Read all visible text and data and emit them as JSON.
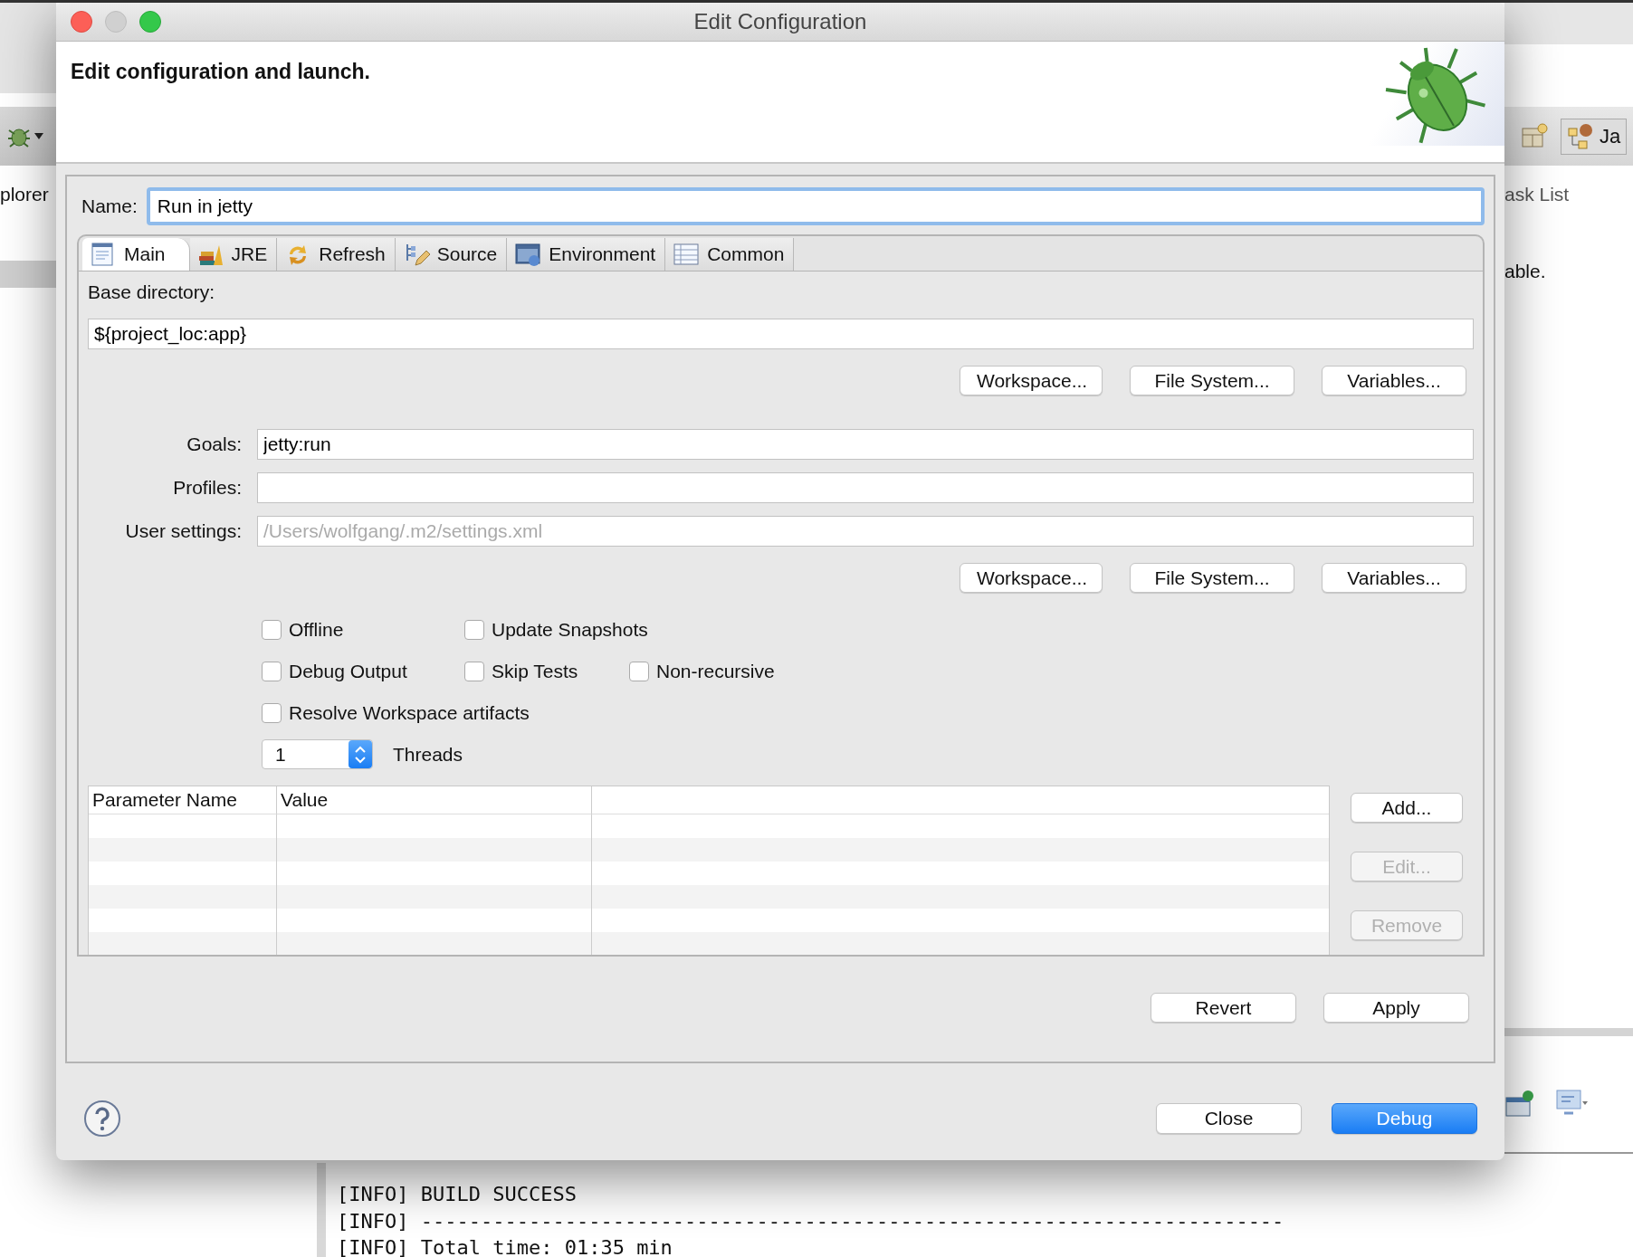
{
  "background": {
    "left_view_tab": "plorer",
    "right_view_tab": "ask List",
    "right_view_text": "able.",
    "perspective": "Ja",
    "console": [
      "[INFO] BUILD SUCCESS",
      "[INFO] ------------------------------------------------------------------------",
      "[INFO] Total time: 01:35 min"
    ]
  },
  "window": {
    "title": "Edit Configuration"
  },
  "header": {
    "message": "Edit configuration and launch."
  },
  "name_field": {
    "label": "Name:",
    "value": "Run in jetty",
    "focused": true
  },
  "tabs": [
    {
      "label": "Main",
      "selected": true
    },
    {
      "label": "JRE",
      "selected": false
    },
    {
      "label": "Refresh",
      "selected": false
    },
    {
      "label": "Source",
      "selected": false
    },
    {
      "label": "Environment",
      "selected": false
    },
    {
      "label": "Common",
      "selected": false
    }
  ],
  "base_directory": {
    "label": "Base directory:",
    "value": "${project_loc:app}",
    "buttons": [
      "Workspace...",
      "File System...",
      "Variables..."
    ]
  },
  "fields": [
    {
      "label": "Goals:",
      "value": "jetty:run"
    },
    {
      "label": "Profiles:"
    },
    {
      "label": "User settings:",
      "placeholder": "/Users/wolfgang/.m2/settings.xml"
    }
  ],
  "settings_buttons": [
    "Workspace...",
    "File System...",
    "Variables..."
  ],
  "options": [
    [
      {
        "label": "Offline",
        "checked": false
      },
      {
        "label": "Update Snapshots",
        "checked": false
      }
    ],
    [
      {
        "label": "Debug Output",
        "checked": false
      },
      {
        "label": "Skip Tests",
        "checked": false
      },
      {
        "label": "Non-recursive",
        "checked": false
      }
    ],
    [
      {
        "label": "Resolve Workspace artifacts",
        "checked": false
      }
    ]
  ],
  "threads": {
    "value": "1",
    "label": "Threads"
  },
  "parameters": {
    "columns": [
      "Parameter Name",
      "Value"
    ],
    "buttons": [
      {
        "label": "Add...",
        "disabled": false
      },
      {
        "label": "Edit...",
        "disabled": true
      },
      {
        "label": "Remove",
        "disabled": true
      }
    ]
  },
  "panel_buttons": [
    "Revert",
    "Apply"
  ],
  "footer_buttons": [
    {
      "label": "Close",
      "default": false
    },
    {
      "label": "Debug",
      "default": true
    }
  ]
}
